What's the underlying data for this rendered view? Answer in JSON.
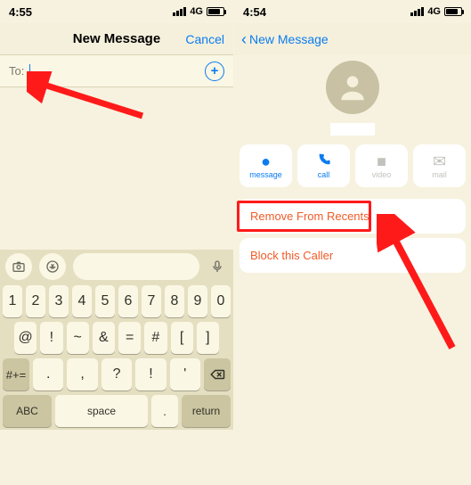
{
  "left": {
    "status": {
      "time": "4:55",
      "net": "4G"
    },
    "nav": {
      "title": "New Message",
      "cancel": "Cancel"
    },
    "to_row": {
      "label": "To:",
      "add_icon": "plus-circle"
    },
    "keyboard": {
      "row1": [
        "1",
        "2",
        "3",
        "4",
        "5",
        "6",
        "7",
        "8",
        "9",
        "0"
      ],
      "row2": [
        "@",
        "!",
        "~",
        "&",
        "=",
        "#",
        "[",
        "]"
      ],
      "shift_icon": "shift",
      "row3": [
        ".",
        ",",
        "?",
        "!",
        "'"
      ],
      "backspace_icon": "backspace",
      "sym_key": "#+=",
      "abc": "ABC",
      "space": "space",
      "return": "return"
    }
  },
  "right": {
    "status": {
      "time": "4:54",
      "net": "4G"
    },
    "nav": {
      "back_label": "New Message"
    },
    "actions": {
      "message": "message",
      "call": "call",
      "video": "video",
      "mail": "mail"
    },
    "remove_recents": "Remove From Recents",
    "block": "Block this Caller"
  }
}
